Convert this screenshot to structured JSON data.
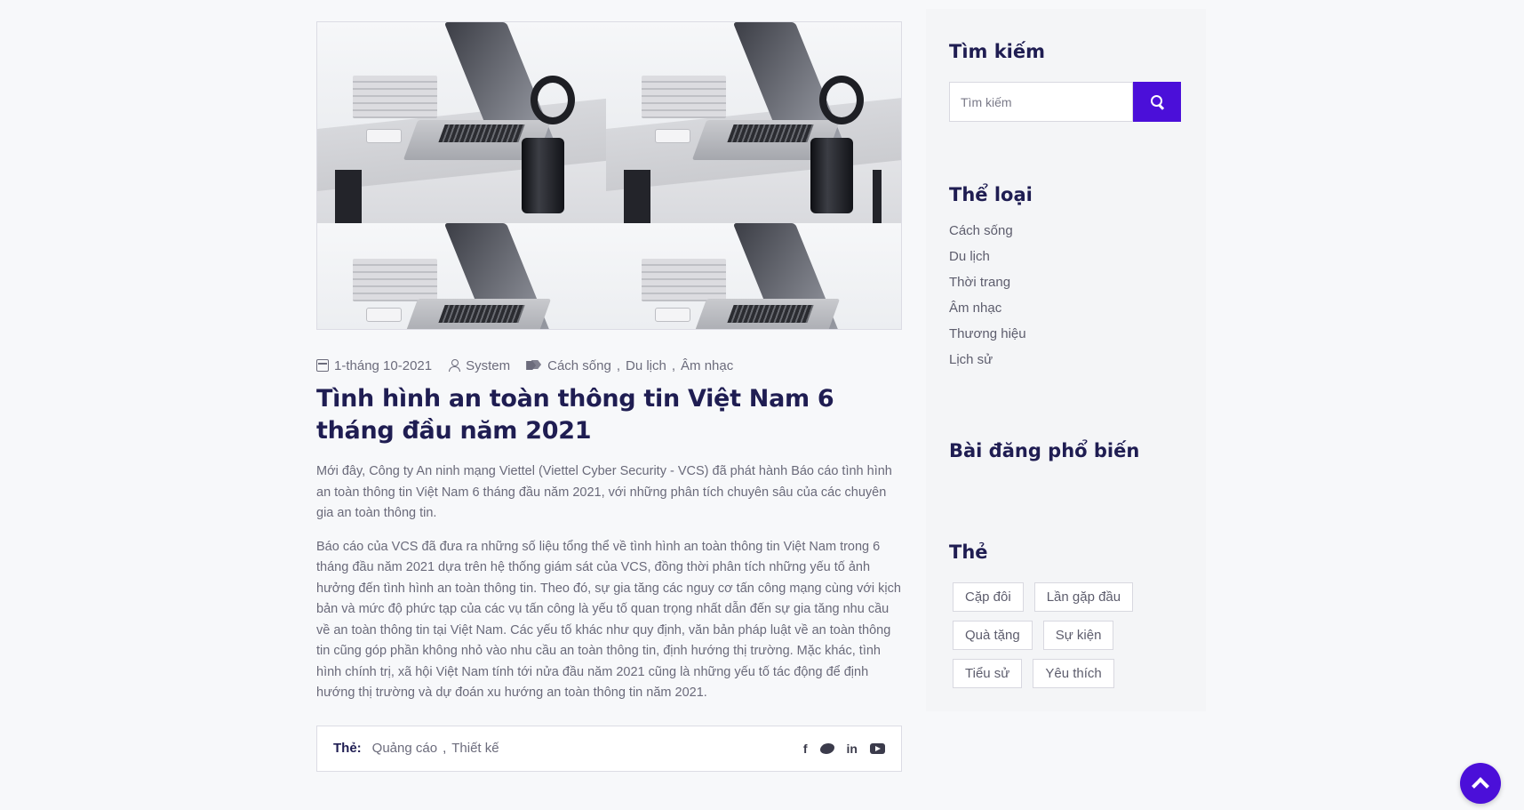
{
  "post": {
    "image_alt": "laptop-desk-photo",
    "date": "1-tháng 10-2021",
    "author": "System",
    "categories": [
      "Cách sống",
      "Du lịch",
      "Âm nhạc"
    ],
    "category_separator": ",",
    "title": "Tình hình an toàn thông tin Việt Nam 6 tháng đầu năm 2021",
    "paragraphs": [
      "Mới đây, Công ty An ninh mạng Viettel (Viettel Cyber Security - VCS) đã phát hành Báo cáo tình hình an toàn thông tin Việt Nam 6 tháng đầu năm 2021, với những phân tích chuyên sâu của các chuyên gia an toàn thông tin.",
      "Báo cáo của VCS đã đưa ra những số liệu tổng thể về tình hình an toàn thông tin Việt Nam trong 6 tháng đầu năm 2021 dựa trên hệ thống giám sát của VCS, đồng thời phân tích những yếu tố ảnh hưởng đến tình hình an toàn thông tin. Theo đó, sự gia tăng các nguy cơ tấn công mạng cùng với kịch bản và mức độ phức tạp của các vụ tấn công là yếu tố quan trọng nhất dẫn đến sự gia tăng nhu cầu về an toàn thông tin tại Việt Nam. Các yếu tố khác như quy định, văn bản pháp luật về an toàn thông tin cũng góp phần không nhỏ vào nhu cầu an toàn thông tin, định hướng thị trường. Mặc khác, tình hình chính trị, xã hội Việt Nam tính tới nửa đầu năm 2021 cũng là những yếu tố tác động để định hướng thị trường và dự đoán xu hướng an toàn thông tin năm 2021."
    ],
    "footer": {
      "tags_label": "Thẻ:",
      "tags": [
        "Quảng cáo",
        "Thiết kế"
      ],
      "tag_separator": ",",
      "social": [
        "facebook-icon",
        "twitter-icon",
        "linkedin-icon",
        "youtube-icon"
      ]
    }
  },
  "sidebar": {
    "search": {
      "title": "Tìm kiếm",
      "placeholder": "Tìm kiếm"
    },
    "categories": {
      "title": "Thể loại",
      "items": [
        "Cách sống",
        "Du lịch",
        "Thời trang",
        "Âm nhạc",
        "Thương hiệu",
        "Lịch sử"
      ]
    },
    "popular": {
      "title": "Bài đăng phổ biến"
    },
    "tags": {
      "title": "Thẻ",
      "items": [
        "Cặp đôi",
        "Lần gặp đầu",
        "Quà tặng",
        "Sự kiện",
        "Tiểu sử",
        "Yêu thích"
      ]
    }
  },
  "colors": {
    "accent": "#4b0fd9",
    "heading": "#1f1d52",
    "text": "#6a6a7a"
  }
}
